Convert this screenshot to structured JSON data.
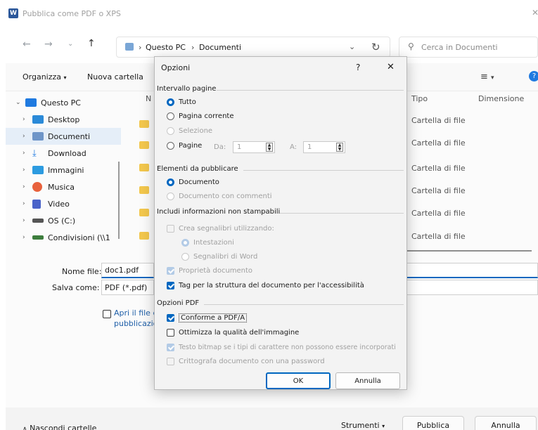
{
  "window": {
    "title": "Pubblica come PDF o XPS",
    "app_icon": "W"
  },
  "nav": {
    "breadcrumb": [
      "Questo PC",
      "Documenti"
    ],
    "search_placeholder": "Cerca in Documenti"
  },
  "toolbar": {
    "organize": "Organizza",
    "new_folder": "Nuova cartella"
  },
  "columns": {
    "name": "N",
    "type": "Tipo",
    "size": "Dimensione"
  },
  "sidebar": {
    "items": [
      {
        "label": "Questo PC",
        "color": "#1f7ae0"
      },
      {
        "label": "Desktop",
        "color": "#2b8ad8"
      },
      {
        "label": "Documenti",
        "color": "#6e95c8"
      },
      {
        "label": "Download",
        "color": "#1f7ae0"
      },
      {
        "label": "Immagini",
        "color": "#2c9be0"
      },
      {
        "label": "Musica",
        "color": "#e8613c"
      },
      {
        "label": "Video",
        "color": "#4a63c9"
      },
      {
        "label": "OS (C:)",
        "color": "#555555"
      },
      {
        "label": "Condivisioni (\\\\1",
        "color": "#3d7d3d"
      }
    ]
  },
  "files": {
    "rows": [
      "Cartella di file",
      "Cartella di file",
      "Cartella di file",
      "Cartella di file",
      "Cartella di file",
      "Cartella di file",
      "Cartella di file"
    ]
  },
  "form": {
    "filename_label": "Nome file:",
    "filename_value": "doc1.pdf",
    "savetype_label": "Salva come:",
    "savetype_value": "PDF (*.pdf)",
    "open_after_line1": "Apri il file d",
    "open_after_line2": "pubblicazio"
  },
  "footer": {
    "hide_folders": "Nascondi cartelle",
    "tools": "Strumenti",
    "publish": "Pubblica",
    "cancel": "Annulla"
  },
  "dialog": {
    "title": "Opzioni",
    "help": "?",
    "close": "✕",
    "range": {
      "label": "Intervallo pagine",
      "all": "Tutto",
      "current": "Pagina corrente",
      "selection": "Selezione",
      "pages": "Pagine",
      "from_label": "Da:",
      "from_value": "1",
      "to_label": "A:",
      "to_value": "1"
    },
    "publish_what": {
      "label": "Elementi da pubblicare",
      "document": "Documento",
      "with_comments": "Documento con commenti"
    },
    "nonprint": {
      "label": "Includi informazioni non stampabili",
      "bookmarks": "Crea segnalibri utilizzando:",
      "headings": "Intestazioni",
      "word_bookmarks": "Segnalibri di Word",
      "properties": "Proprietà documento",
      "tags": "Tag per la struttura del documento per l'accessibilità"
    },
    "pdf": {
      "label": "Opzioni PDF",
      "pdfa": "Conforme a PDF/A",
      "optimize": "Ottimizza la qualità dell'immagine",
      "bitmap": "Testo bitmap se i tipi di carattere non possono essere incorporati",
      "encrypt": "Crittografa documento con una password"
    },
    "ok": "OK",
    "cancel": "Annulla"
  }
}
